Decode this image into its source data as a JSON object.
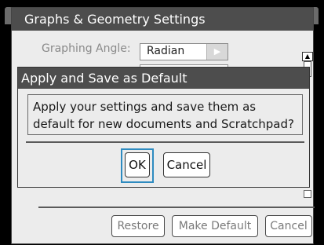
{
  "settings_window": {
    "title": "Graphs & Geometry Settings",
    "graphing_angle_label": "Graphing Angle:",
    "graphing_angle_value": "Radian",
    "footer": {
      "restore_label": "Restore",
      "make_default_label": "Make Default",
      "cancel_label": "Cancel"
    }
  },
  "dialog": {
    "title": "Apply and Save as Default",
    "message": "Apply your settings and save them as default for new documents and Scratchpad?",
    "ok_label": "OK",
    "cancel_label": "Cancel"
  },
  "icons": {
    "dropdown_arrow": "chevron-right-icon",
    "scroll_up": "scroll-up-icon"
  },
  "colors": {
    "titlebar": "#4d4d4d",
    "focus_ring": "#2e8bc0",
    "background": "#000000",
    "panel": "#ececec"
  }
}
